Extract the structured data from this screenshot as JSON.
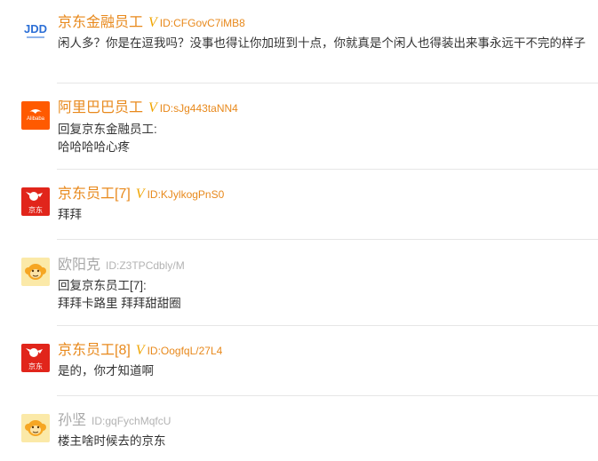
{
  "comments": [
    {
      "avatar": "jdd-logo-icon",
      "name": "京东金融员工",
      "verified": "V",
      "id_text": "ID:CFGovC7iMB8",
      "body": "闲人多？你是在逗我吗？没事也得让你加班到十点，你就真是个闲人也得装出来事永远干不完的样子"
    },
    {
      "avatar": "alibaba-logo-icon",
      "name": "阿里巴巴员工",
      "verified": "V",
      "id_text": "ID:sJg443taNN4",
      "reply_to": "回复京东金融员工:",
      "body": "哈哈哈哈心疼"
    },
    {
      "avatar": "jd-dog-logo-icon",
      "name": "京东员工[7]",
      "verified": "V",
      "id_text": "ID:KJylkogPnS0",
      "body": "拜拜"
    },
    {
      "avatar": "monkey-avatar-icon",
      "name": "欧阳克",
      "id_text": "ID:Z3TPCdbly/M",
      "reply_to": "回复京东员工[7]:",
      "body": "拜拜卡路里 拜拜甜甜圈"
    },
    {
      "avatar": "jd-dog-logo-icon",
      "name": "京东员工[8]",
      "verified": "V",
      "id_text": "ID:OogfqL/27L4",
      "body": "是的，你才知道啊"
    },
    {
      "avatar": "monkey-avatar-icon",
      "name": "孙坚",
      "id_text": "ID:gqFychMqfcU",
      "body": "楼主啥时候去的京东"
    }
  ],
  "colors": {
    "staff_name": "#e8891c",
    "user_name": "#a8a8a8",
    "verified": "#f0a500",
    "separator": "#e6e6e6",
    "body_text": "#333333"
  },
  "logo_text": {
    "jdd": "JDD",
    "jd": "京东",
    "alibaba": "Alibaba"
  }
}
